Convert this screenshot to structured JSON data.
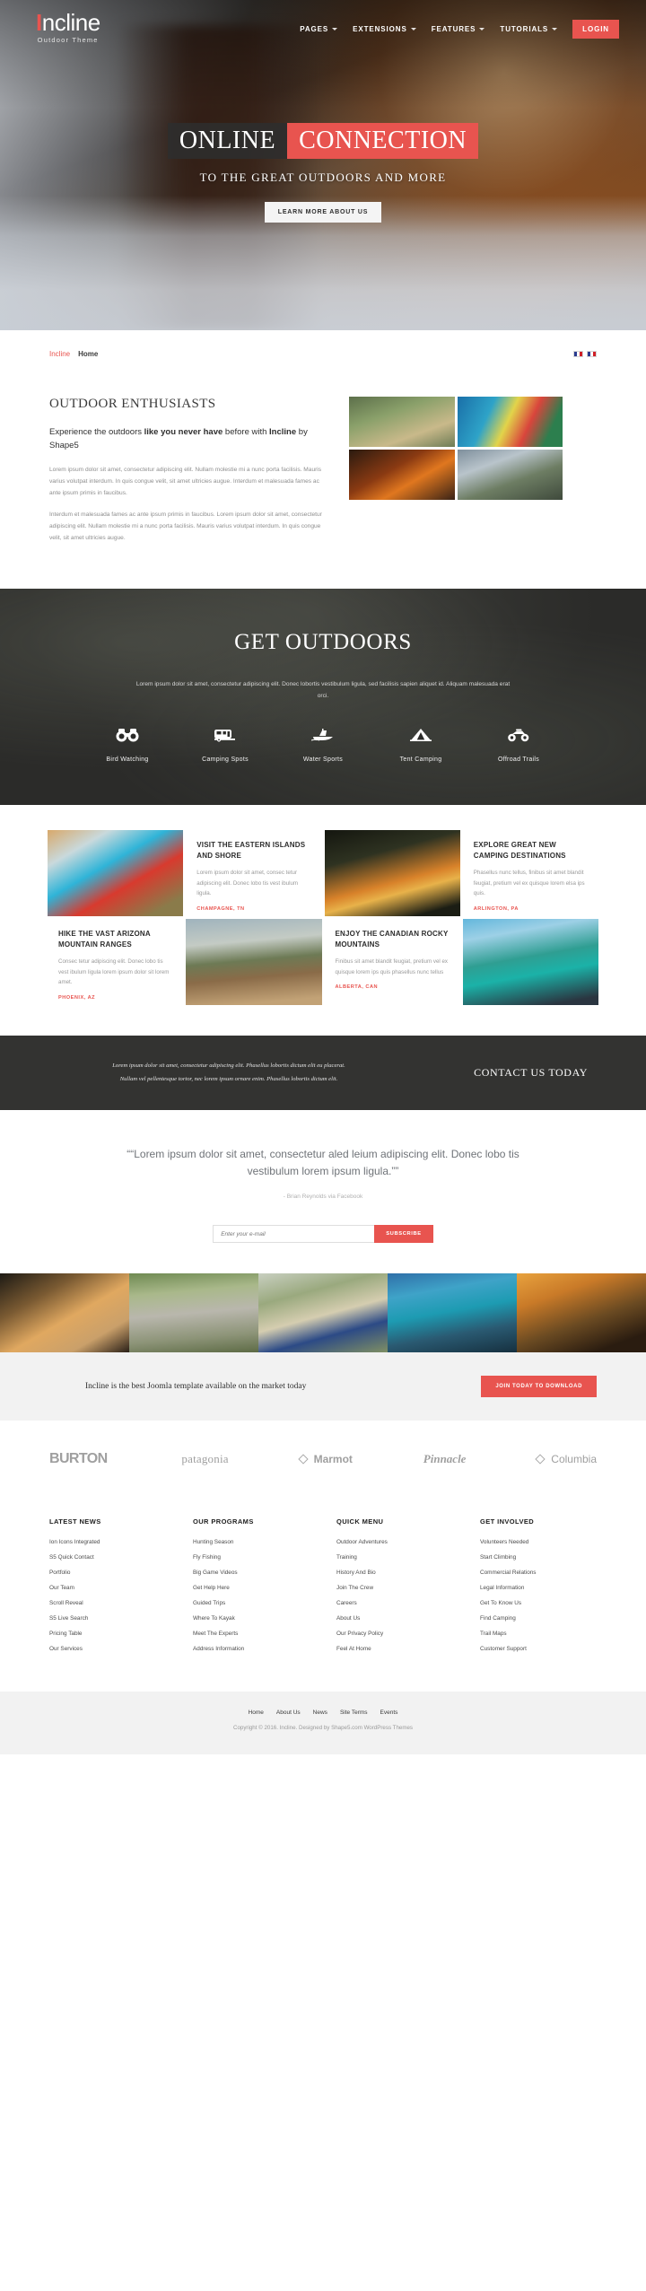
{
  "header": {
    "logo_main": "ncline",
    "logo_i": "I",
    "logo_sub": "Outdoor Theme",
    "nav": [
      {
        "label": "PAGES",
        "caret": "chevron-down-icon"
      },
      {
        "label": "EXTENSIONS",
        "caret": "chevron-down-icon"
      },
      {
        "label": "FEATURES",
        "caret": "chevron-down-icon"
      },
      {
        "label": "TUTORIALS",
        "caret": "chevron-down-icon"
      }
    ],
    "login_label": "LOGIN"
  },
  "hero": {
    "title_part1": "ONLINE",
    "title_part2": "CONNECTION",
    "subtitle": "TO THE GREAT OUTDOORS AND MORE",
    "button_label": "LEARN MORE ABOUT US"
  },
  "breadcrumb": {
    "site": "Incline",
    "current": "Home"
  },
  "enthusiasts": {
    "heading": "OUTDOOR ENTHUSIASTS",
    "lead_a": "Experience the outdoors ",
    "lead_b": "like you never have",
    "lead_c": " before with ",
    "lead_d": "Incline",
    "lead_e": " by Shape5",
    "para1": "Lorem ipsum dolor sit amet, consectetur adipiscing elit. Nullam molestie mi a nunc porta facilisis. Mauris varius volutpat interdum. In quis congue velit, sit amet ultricies augue. Interdum et malesuada fames ac ante ipsum primis in faucibus.",
    "para2": "Interdum et malesuada fames ac ante ipsum primis in faucibus. Lorem ipsum dolor sit amet, consectetur adipiscing elit. Nullam molestie mi a nunc porta facilisis. Mauris varius volutpat interdum. In quis congue velit, sit amet ultricies augue."
  },
  "outdoors": {
    "heading": "GET OUTDOORS",
    "subtext": "Lorem ipsum dolor sit amet, consectetur adipiscing elit. Donec lobortis vestibulum ligula, sed facilisis sapien aliquet id. Aliquam malesuada erat orci.",
    "features": [
      {
        "label": "Bird Watching",
        "icon": "binoculars-icon"
      },
      {
        "label": "Camping Spots",
        "icon": "camper-trailer-icon"
      },
      {
        "label": "Water Sports",
        "icon": "speedboat-icon"
      },
      {
        "label": "Tent Camping",
        "icon": "tent-icon"
      },
      {
        "label": "Offroad Trails",
        "icon": "atv-icon"
      }
    ]
  },
  "cards": [
    {
      "title": "VISIT THE EASTERN ISLANDS AND SHORE",
      "body": "Lorem ipsum dolor sit amet, consec tetur adipiscing elit. Donec lobo tis vest ibulum ligula.",
      "location": "CHAMPAGNE, TN"
    },
    {
      "title": "EXPLORE GREAT NEW CAMPING DESTINATIONS",
      "body": "Phasellus nunc tellus, finibus sit amet blandit feugiat, pretium vel ex quisque lorem elsa ips quis.",
      "location": "ARLINGTON, PA"
    },
    {
      "title": "HIKE THE VAST ARIZONA MOUNTAIN RANGES",
      "body": "Consec tetur adipiscing elit. Donec lobo tis vest ibulum ligula lorem ipsum dolor sit lorem amet.",
      "location": "PHOENIX, AZ"
    },
    {
      "title": "ENJOY THE CANADIAN ROCKY MOUNTAINS",
      "body": "Finibus sit amet blandit feugiat, pretium vel ex quisque lorem ips quis phasellus nunc tellus",
      "location": "ALBERTA, CAN"
    }
  ],
  "contact_band": {
    "line1": "Lorem ipsum dolor sit amet, consectetur adipiscing elit. Phasellus lobortis dictum elit eu placerat.",
    "line2": "Nullam vel pellentesque tortor, nec lorem ipsum ornare enim. Phasellus lobortis dictum elit.",
    "cta": "CONTACT US TODAY"
  },
  "testimonial": {
    "quote": "“Lorem ipsum dolor sit amet, consectetur aled leium adipiscing elit. Donec lobo tis vestibulum lorem ipsum ligula.”",
    "author": "- Brian Reynolds via Facebook",
    "input_placeholder": "Enter your e-mail",
    "subscribe_label": "SUBSCRIBE"
  },
  "cta": {
    "text": "Incline is the best Joomla template available on the market today",
    "button": "JOIN TODAY TO DOWNLOAD"
  },
  "brands": [
    {
      "name": "BURTON",
      "kind": "burton"
    },
    {
      "name": "patagonia",
      "kind": "patagonia"
    },
    {
      "name": "Marmot",
      "kind": "marmot"
    },
    {
      "name": "Pinnacle",
      "kind": "pinnacle"
    },
    {
      "name": "Columbia",
      "kind": "columbia"
    }
  ],
  "footer": {
    "columns": [
      {
        "title": "LATEST NEWS",
        "links": [
          "Ion Icons Integrated",
          "S5 Quick Contact",
          "Portfolio",
          "Our Team",
          "Scroll Reveal",
          "S5 Live Search",
          "Pricing Table",
          "Our Services"
        ]
      },
      {
        "title": "OUR PROGRAMS",
        "links": [
          "Hunting Season",
          "Fly Fishing",
          "Big Game Videos",
          "Get Help Here",
          "Guided Trips",
          "Where To Kayak",
          "Meet The Experts",
          "Address Information"
        ]
      },
      {
        "title": "QUICK MENU",
        "links": [
          "Outdoor Adventures",
          "Training",
          "History And Bio",
          "Join The Crew",
          "Careers",
          "About Us",
          "Our Privacy Policy",
          "Feel At Home"
        ]
      },
      {
        "title": "GET INVOLVED",
        "links": [
          "Volunteers Needed",
          "Start Climbing",
          "Commercial Relations",
          "Legal Information",
          "Get To Know Us",
          "Find Camping",
          "Trail Maps",
          "Customer Support"
        ]
      }
    ]
  },
  "bottom": {
    "nav": [
      "Home",
      "About Us",
      "News",
      "Site Terms",
      "Events"
    ],
    "copyright": "Copyright © 2016. Incline. Designed by Shape5.com WordPress Themes"
  },
  "colors": {
    "accent": "#e8544f",
    "dark": "#2b2b29",
    "band": "#333331",
    "light": "#f2f2f2"
  }
}
